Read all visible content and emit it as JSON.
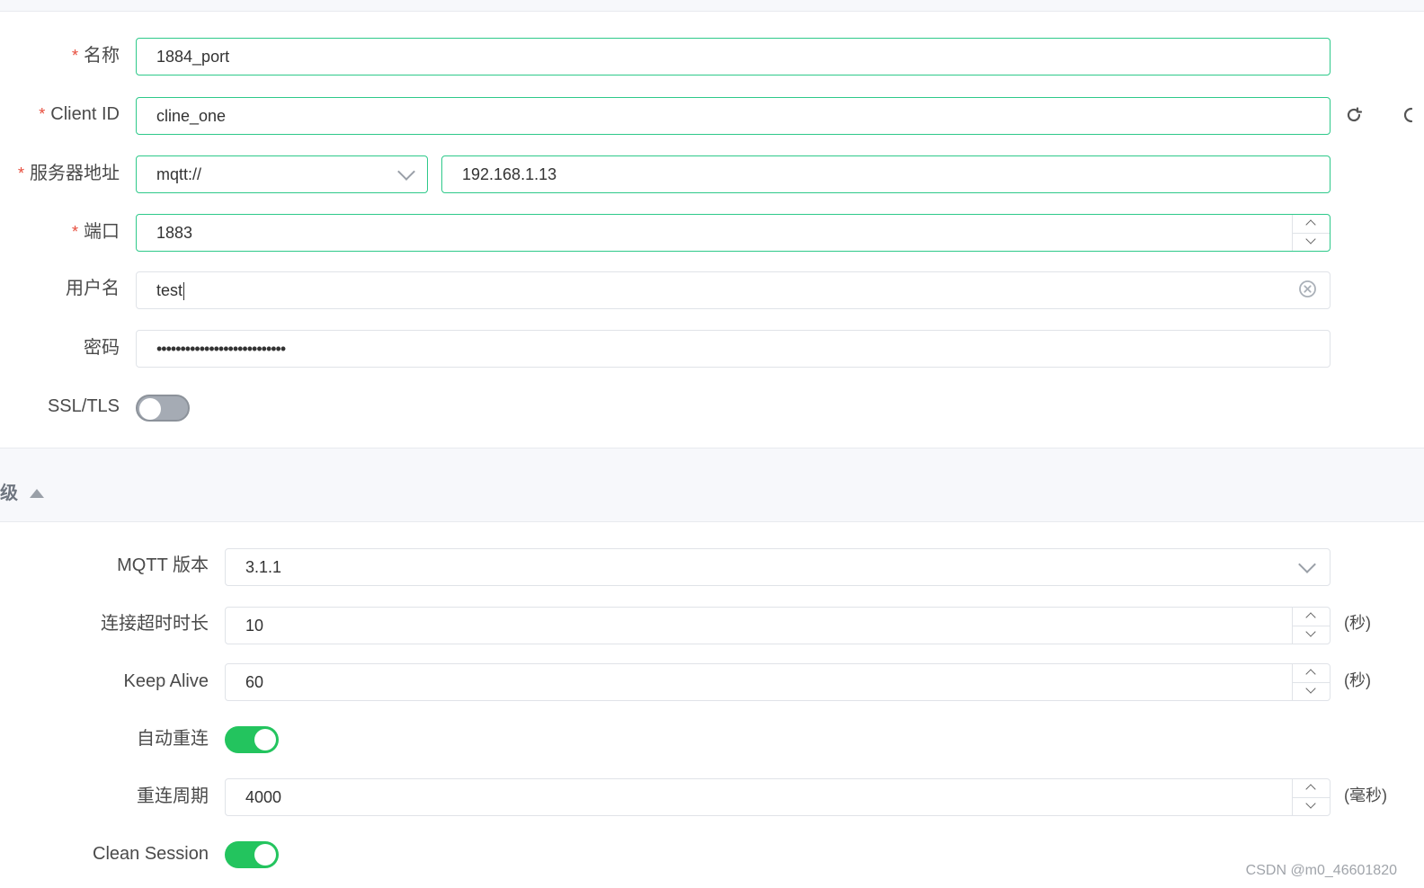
{
  "form": {
    "name": {
      "label": "名称",
      "value": "1884_port"
    },
    "client_id": {
      "label": "Client ID",
      "value": "cline_one"
    },
    "server": {
      "label": "服务器地址",
      "protocol": "mqtt://",
      "host": "192.168.1.13"
    },
    "port": {
      "label": "端口",
      "value": "1883"
    },
    "username": {
      "label": "用户名",
      "value": "test"
    },
    "password": {
      "label": "密码",
      "value": "•••••••••••••••••••••••••••"
    },
    "ssl": {
      "label": "SSL/TLS",
      "enabled": false
    },
    "required_mark": "*"
  },
  "advanced": {
    "title": "高级",
    "mqtt_version": {
      "label": "MQTT 版本",
      "value": "3.1.1"
    },
    "connect_timeout": {
      "label": "连接超时时长",
      "value": "10",
      "unit": "(秒)"
    },
    "keep_alive": {
      "label": "Keep Alive",
      "value": "60",
      "unit": "(秒)"
    },
    "auto_reconnect": {
      "label": "自动重连",
      "enabled": true
    },
    "reconnect_period": {
      "label": "重连周期",
      "value": "4000",
      "unit": "(毫秒)"
    },
    "clean_session": {
      "label": "Clean Session",
      "enabled": true
    }
  },
  "watermark": "CSDN @m0_46601820",
  "colors": {
    "accent": "#2ec98a",
    "toggle_on": "#23c45e",
    "required": "#e74c3c"
  }
}
